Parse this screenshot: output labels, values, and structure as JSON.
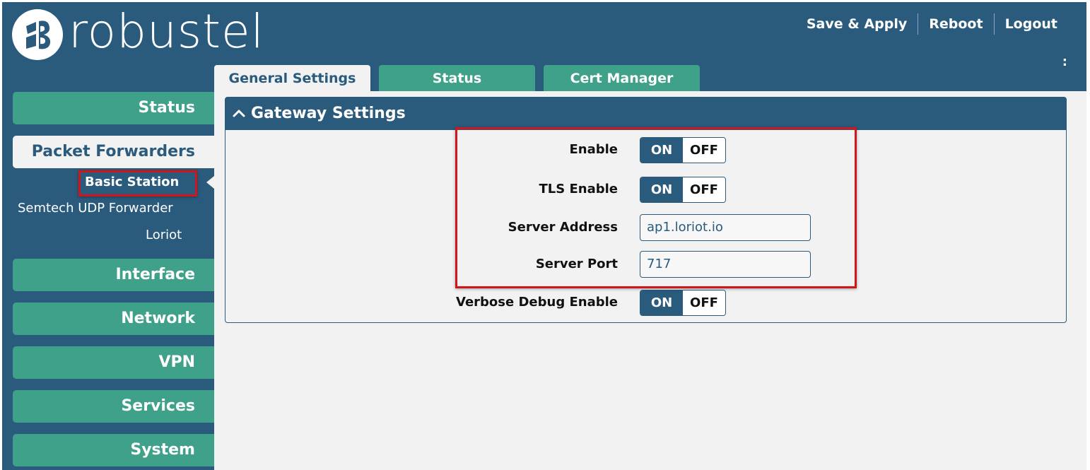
{
  "brand": {
    "name": "robustel",
    "logo_icon": "robustel-logo-icon"
  },
  "top_links": {
    "save_apply": "Save & Apply",
    "reboot": "Reboot",
    "logout": "Logout",
    "extra": ":"
  },
  "tabs": [
    {
      "label": "General Settings",
      "active": true
    },
    {
      "label": "Status",
      "active": false
    },
    {
      "label": "Cert Manager",
      "active": false
    }
  ],
  "sidebar": {
    "items": [
      {
        "label": "Status"
      },
      {
        "label": "Packet Forwarders",
        "active": true
      },
      {
        "label": "Interface"
      },
      {
        "label": "Network"
      },
      {
        "label": "VPN"
      },
      {
        "label": "Services"
      },
      {
        "label": "System"
      }
    ],
    "subitems": [
      {
        "label": "Basic Station",
        "active": true
      },
      {
        "label": "Semtech UDP Forwarder"
      },
      {
        "label": "Loriot"
      }
    ]
  },
  "panel": {
    "title": "Gateway Settings",
    "collapse_icon": "chevron-up-icon",
    "fields": {
      "enable": {
        "label": "Enable",
        "on": "ON",
        "off": "OFF",
        "state": "ON"
      },
      "tls_enable": {
        "label": "TLS Enable",
        "on": "ON",
        "off": "OFF",
        "state": "ON"
      },
      "server_address": {
        "label": "Server Address",
        "value": "ap1.loriot.io"
      },
      "server_port": {
        "label": "Server Port",
        "value": "717"
      },
      "verbose_debug": {
        "label": "Verbose Debug Enable",
        "on": "ON",
        "off": "OFF",
        "state": "ON"
      }
    }
  },
  "colors": {
    "primary": "#2a5b7d",
    "accent": "#3fa18a",
    "content_bg": "#f2f2f2",
    "highlight": "#d0151b"
  }
}
